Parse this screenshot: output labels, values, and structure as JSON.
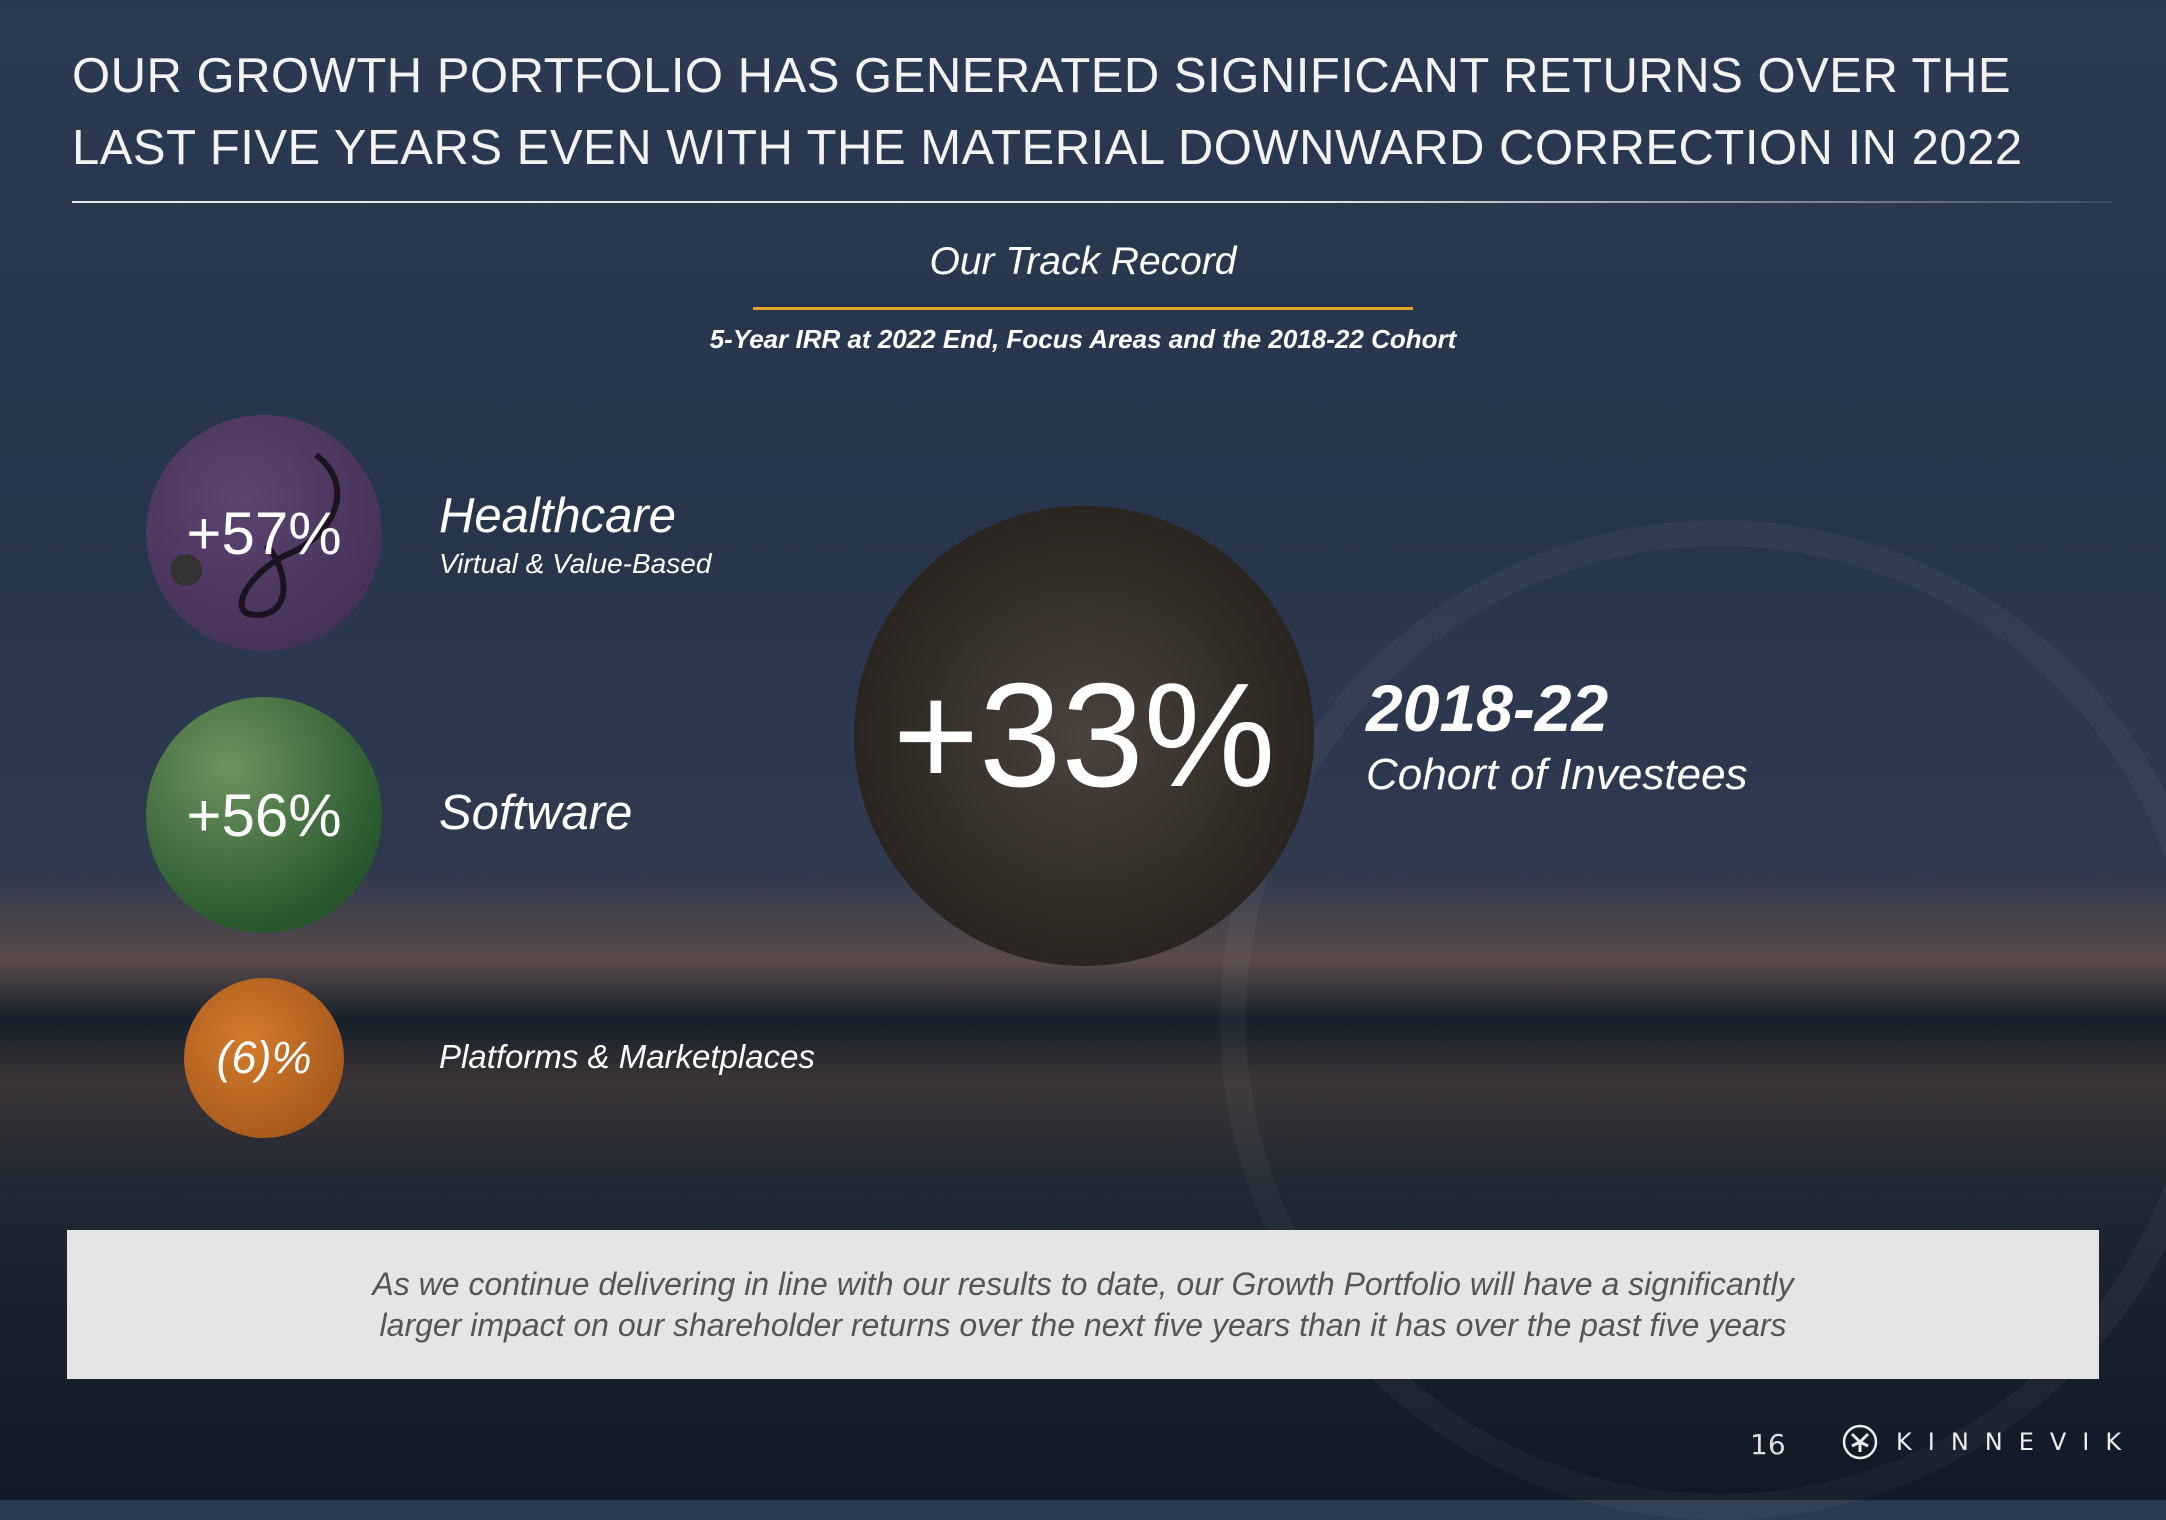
{
  "title": {
    "line1": "OUR GROWTH PORTFOLIO HAS GENERATED SIGNIFICANT RETURNS OVER THE",
    "line2": "LAST FIVE YEARS EVEN WITH THE MATERIAL DOWNWARD CORRECTION IN 2022"
  },
  "section": {
    "heading": "Our Track Record",
    "subtitle": "5-Year IRR at 2022 End, Focus Areas and the 2018-22 Cohort",
    "accent": "#e0a526"
  },
  "focus_areas": [
    {
      "value": "+57%",
      "name": "Healthcare",
      "detail": "Virtual & Value-Based",
      "color": "#4e3862",
      "icon": "stethoscope-image"
    },
    {
      "value": "+56%",
      "name": "Software",
      "color": "#3a6b3a"
    },
    {
      "value": "(6)%",
      "name": "Platforms & Marketplaces",
      "color": "#c06a24",
      "icon": "shopping-cart-image"
    }
  ],
  "cohort": {
    "value": "+33%",
    "years": "2018-22",
    "label": "Cohort of Investees"
  },
  "callout": {
    "line1": "As we continue delivering in line with our results to date, our Growth Portfolio will have a significantly",
    "line2": "larger impact on our shareholder returns over the next five years than it has over the past five years"
  },
  "footer": {
    "page": "16",
    "brand": "KINNEVIK"
  }
}
